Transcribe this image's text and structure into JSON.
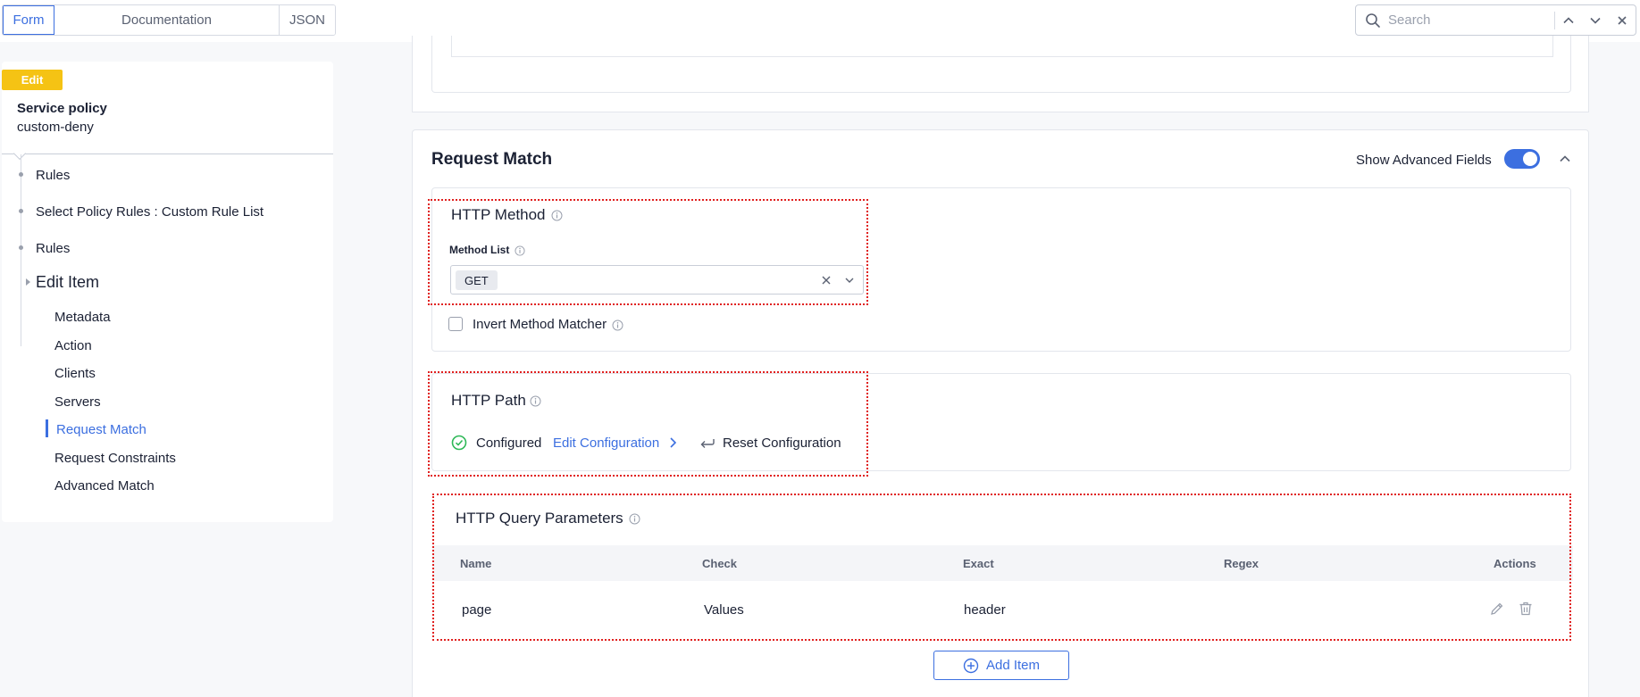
{
  "header": {
    "tabs": [
      {
        "label": "Form",
        "active": true
      },
      {
        "label": "Documentation",
        "active": false
      },
      {
        "label": "JSON",
        "active": false
      }
    ],
    "search": {
      "placeholder": "Search",
      "value": ""
    }
  },
  "sidebar": {
    "badge": "Edit",
    "title": "Service policy",
    "name": "custom-deny",
    "breadcrumbs": [
      "Rules",
      "Select Policy Rules : Custom Rule List",
      "Rules"
    ],
    "current": "Edit Item",
    "nav": [
      {
        "label": "Metadata",
        "active": false
      },
      {
        "label": "Action",
        "active": false
      },
      {
        "label": "Clients",
        "active": false
      },
      {
        "label": "Servers",
        "active": false
      },
      {
        "label": "Request Match",
        "active": true
      },
      {
        "label": "Request Constraints",
        "active": false
      },
      {
        "label": "Advanced Match",
        "active": false
      }
    ]
  },
  "main": {
    "section_title": "Request Match",
    "advanced_fields_label": "Show Advanced Fields",
    "advanced_fields_on": true,
    "http_method": {
      "title": "HTTP Method",
      "method_list_label": "Method List",
      "selected": [
        "GET"
      ],
      "invert_label": "Invert Method Matcher",
      "invert_checked": false
    },
    "http_path": {
      "title": "HTTP Path",
      "status": "Configured",
      "edit_label": "Edit Configuration",
      "reset_label": "Reset Configuration"
    },
    "query_params": {
      "title": "HTTP Query Parameters",
      "columns": [
        "Name",
        "Check",
        "Exact",
        "Regex",
        "Actions"
      ],
      "rows": [
        {
          "name": "page",
          "check": "Values",
          "exact": "header",
          "regex": ""
        }
      ],
      "add_label": "Add Item"
    }
  },
  "colors": {
    "accent": "#3c6fe0",
    "badge": "#f5c314",
    "highlight": "#e0201f",
    "success": "#2eb857"
  }
}
